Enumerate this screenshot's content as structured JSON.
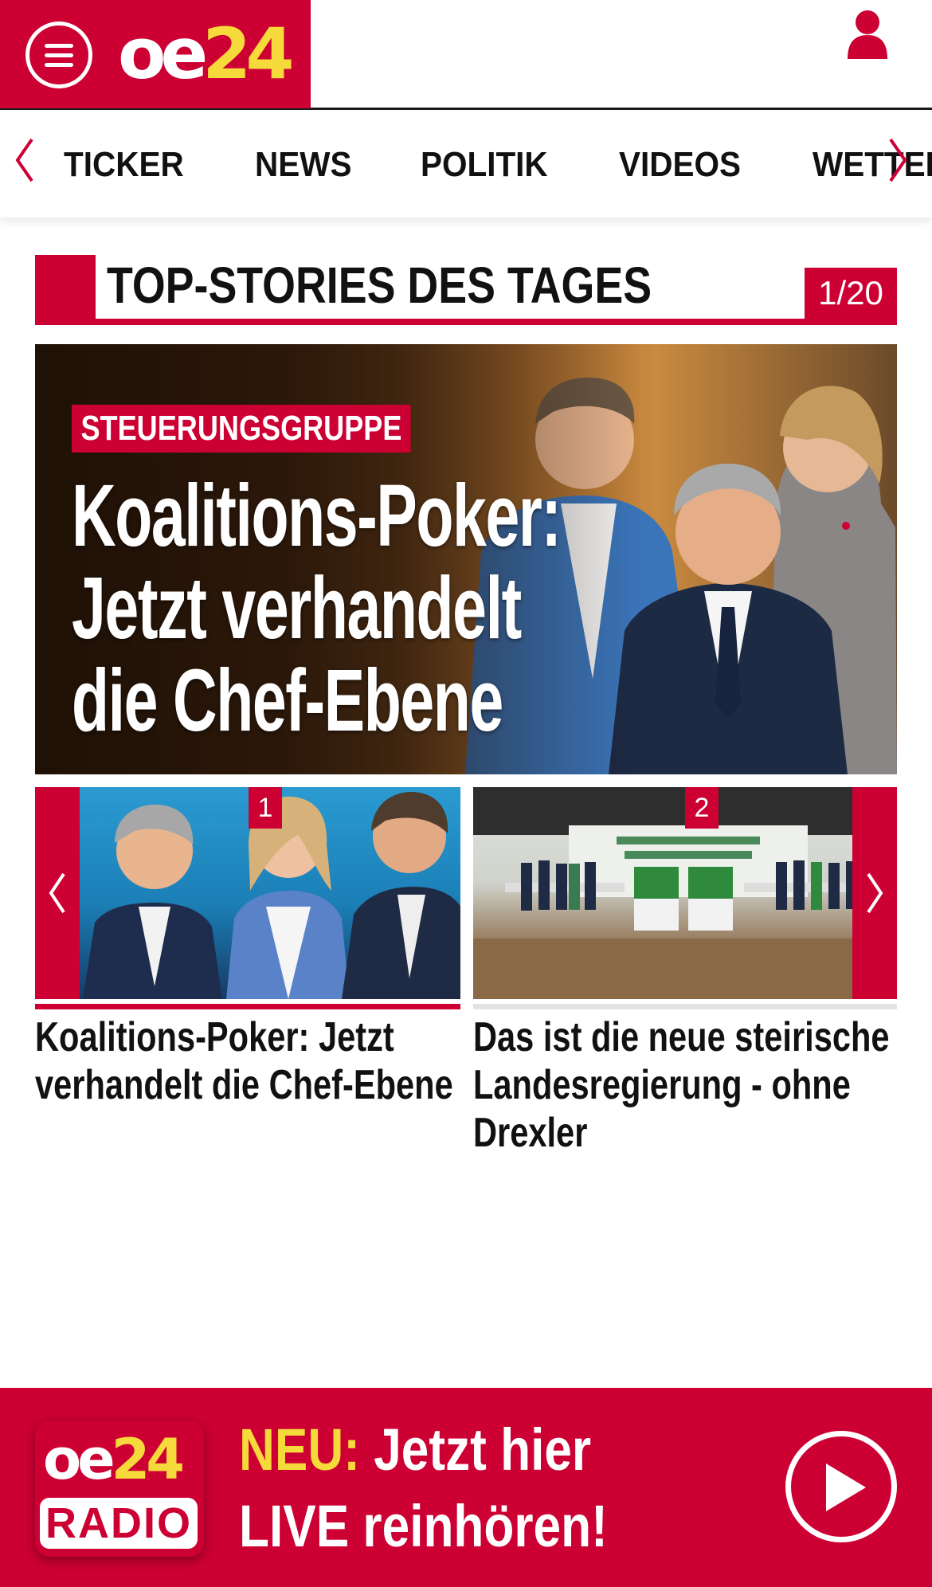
{
  "header": {
    "logo": {
      "part1": "oe",
      "part2": "24"
    },
    "icons": {
      "menu": "hamburger-menu-icon",
      "user": "user-icon"
    },
    "colors": {
      "brand": "#cc0033",
      "accent": "#f6d93a"
    }
  },
  "nav": {
    "items": [
      {
        "label": "TICKER"
      },
      {
        "label": "NEWS"
      },
      {
        "label": "POLITIK"
      },
      {
        "label": "VIDEOS"
      },
      {
        "label": "WETTER"
      }
    ],
    "icons": {
      "prev": "chevron-left-icon",
      "next": "chevron-right-icon"
    }
  },
  "section": {
    "title": "TOP-STORIES DES TAGES",
    "counter": "1/20"
  },
  "hero": {
    "kicker": "STEUERUNGSGRUPPE",
    "title": "Koalitions-Poker: Jetzt verhandelt die Chef-Ebene"
  },
  "teasers": [
    {
      "number": "1",
      "title": "Koalitions-Poker: Jetzt verhandelt die Chef-Ebene"
    },
    {
      "number": "2",
      "title": "Das ist die neue steirische Landesregierung - ohne Drexler"
    }
  ],
  "radio": {
    "logo_top": {
      "part1": "oe",
      "part2": "24"
    },
    "logo_bottom": "RADIO",
    "highlight": "NEU:",
    "line1": "Jetzt hier",
    "line2": "LIVE reinhören!",
    "icons": {
      "play": "play-icon"
    }
  }
}
